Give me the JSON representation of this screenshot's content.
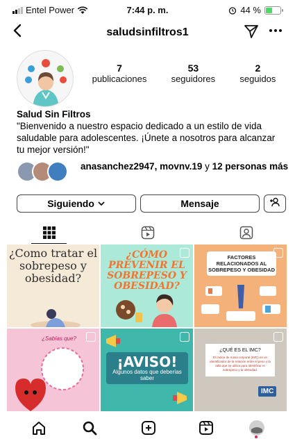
{
  "status_bar": {
    "carrier": "Entel Power",
    "time": "7:44 p. m.",
    "battery_percent": "44 %",
    "battery_level": 0.44,
    "icons": [
      "signal-icon",
      "wifi-icon",
      "alarm-icon",
      "battery-charging-icon"
    ]
  },
  "header": {
    "back_icon": "chevron-left-icon",
    "username": "saludsinfiltros1",
    "send_icon": "paper-plane-icon",
    "more_icon": "more-horizontal-icon"
  },
  "profile": {
    "stats": [
      {
        "value": "7",
        "label": "publicaciones"
      },
      {
        "value": "53",
        "label": "seguidores"
      },
      {
        "value": "2",
        "label": "seguidos"
      }
    ],
    "name": "Salud Sin Filtros",
    "bio": "\"Bienvenido a nuestro espacio dedicado a un estilo de vida saludable para adolescentes. ¡Únete a nosotros para alcanzar tu mejor versión!\""
  },
  "followed_by": {
    "users": "anasanchez2947, movnv.19",
    "connector": " y ",
    "others": "12 personas más"
  },
  "actions": {
    "follow_label": "Siguiendo",
    "follow_icon": "chevron-down-icon",
    "message_label": "Mensaje",
    "add_icon": "add-person-icon"
  },
  "tabs": [
    {
      "icon": "grid-icon",
      "active": true
    },
    {
      "icon": "reels-icon",
      "active": false
    },
    {
      "icon": "tagged-icon",
      "active": false
    }
  ],
  "posts": [
    {
      "text": "¿Como tratar el sobrepeso y obesidad?"
    },
    {
      "text": "¿CÓMO PREVENIR EL SOBREPESO Y OBESIDAD?"
    },
    {
      "text": "FACTORES RELACIONADOS AL SOBREPESO Y OBESIDAD"
    },
    {
      "text": "¿Sabías que?"
    },
    {
      "title": "¡AVISO!",
      "text": "Algunos datos que deberías saber"
    },
    {
      "title": "¿QUÉ ES EL IMC?",
      "text": "El índice de masa corporal (IMC) es un identificador de la relación entre el peso y la talla que se utiliza para identificar el sobrepeso y la obesidad.",
      "badge": "IMC"
    }
  ],
  "bottom_nav": [
    {
      "icon": "home-icon"
    },
    {
      "icon": "search-icon"
    },
    {
      "icon": "create-icon"
    },
    {
      "icon": "reels-icon"
    },
    {
      "icon": "profile-avatar-icon"
    }
  ],
  "colors": {
    "accent_red": "#e0245e",
    "battery_green": "#4cd964"
  }
}
